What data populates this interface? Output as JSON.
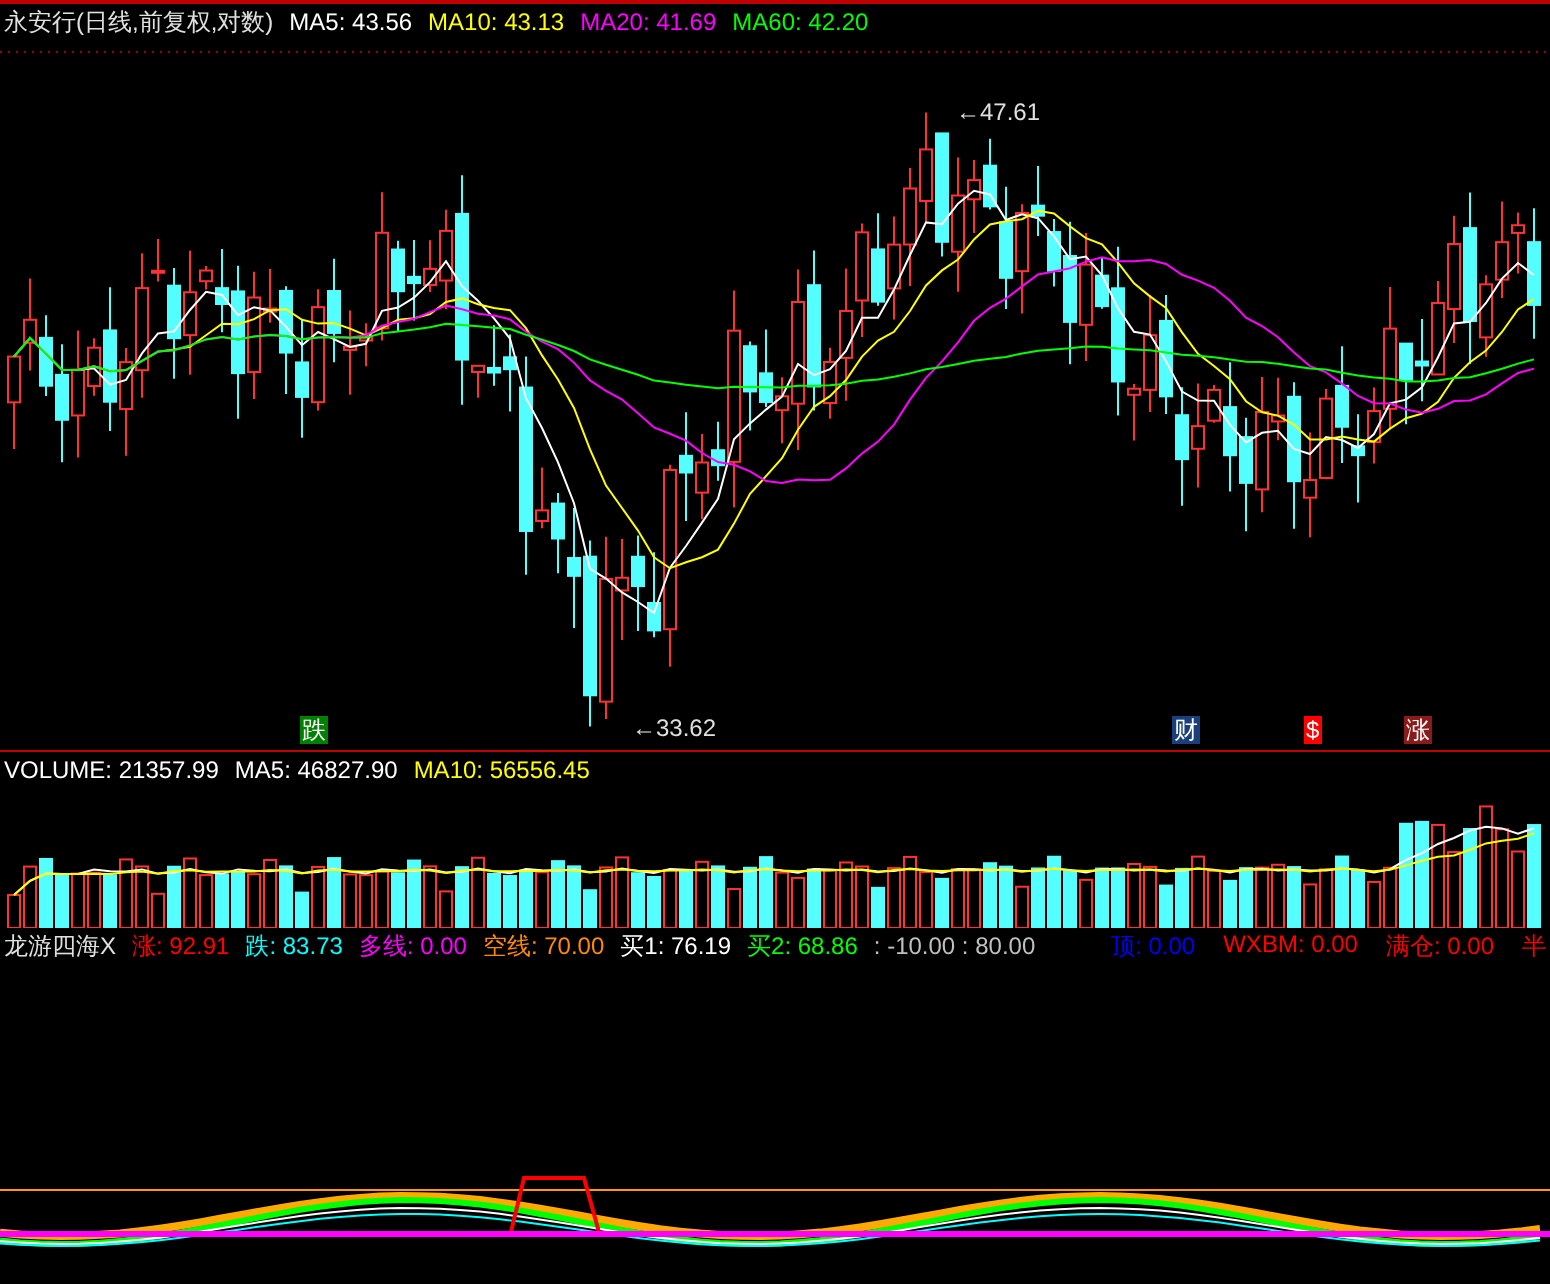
{
  "main_panel": {
    "title": "永安行(日线,前复权,对数)",
    "legend": [
      {
        "label": "MA5: 43.56",
        "color": "#ffffff"
      },
      {
        "label": "MA10: 43.13",
        "color": "#ffff00"
      },
      {
        "label": "MA20: 41.69",
        "color": "#ff00ff"
      },
      {
        "label": "MA60: 42.20",
        "color": "#00ff00"
      }
    ],
    "high_label": "←47.61",
    "low_label": "←33.62",
    "markers": [
      {
        "text": "跌",
        "color": "#008000"
      },
      {
        "text": "财",
        "color": "#1a3f7a"
      },
      {
        "text": "$",
        "color": "#ff0000"
      },
      {
        "text": "涨",
        "color": "#8b1a1a"
      }
    ]
  },
  "volume_panel": {
    "legend": [
      {
        "label": "VOLUME: 21357.99",
        "color": "#ffffff"
      },
      {
        "label": "MA5: 46827.90",
        "color": "#ffffff"
      },
      {
        "label": "MA10: 56556.45",
        "color": "#ffff00"
      }
    ]
  },
  "indicator_panel": {
    "title": "龙游四海X",
    "legend": [
      {
        "label": "涨: 92.91",
        "color": "#ff0000"
      },
      {
        "label": "跌: 83.73",
        "color": "#00ffff"
      },
      {
        "label": "多线: 0.00",
        "color": "#ff00ff"
      },
      {
        "label": "空线: 70.00",
        "color": "#ff8c00"
      },
      {
        "label": "买1: 76.19",
        "color": "#ffffff"
      },
      {
        "label": "买2: 68.86",
        "color": "#00ff00"
      },
      {
        "label": ": -10.00 : 80.00",
        "color": "#c0c0c0"
      }
    ],
    "legend_right": [
      {
        "label": "顶: 0.00",
        "color": "#0000ff"
      },
      {
        "label": "WXBM: 0.00",
        "color": "#ff0000"
      },
      {
        "label": "满仓: 0.00",
        "color": "#ff0000"
      },
      {
        "label": "半",
        "color": "#ff0000"
      }
    ]
  }
}
